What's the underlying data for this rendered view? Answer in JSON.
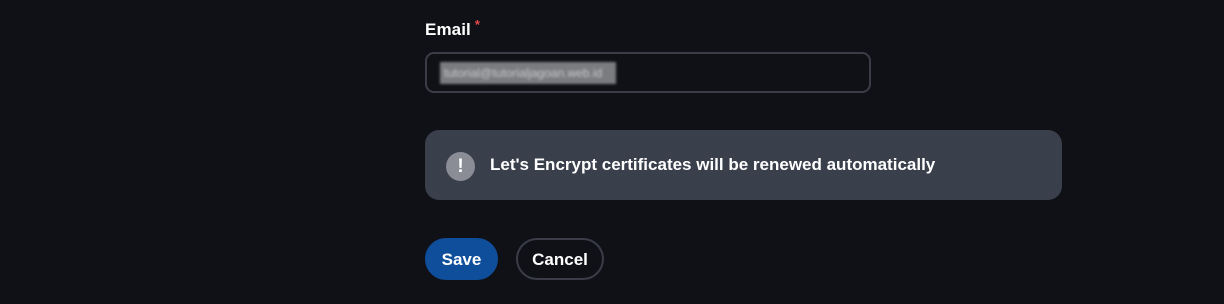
{
  "form": {
    "email_label": "Email",
    "required_marker": "*",
    "email_value": "tutorial@tutorialjagoan.web.id"
  },
  "notice": {
    "icon": "exclamation-icon",
    "icon_glyph": "!",
    "text": "Let's Encrypt certificates will be renewed automatically"
  },
  "actions": {
    "save_label": "Save",
    "cancel_label": "Cancel"
  },
  "colors": {
    "background": "#101116",
    "primary": "#0f4e9a",
    "required": "#e5484d",
    "notice_bg": "#3a3f4c"
  }
}
